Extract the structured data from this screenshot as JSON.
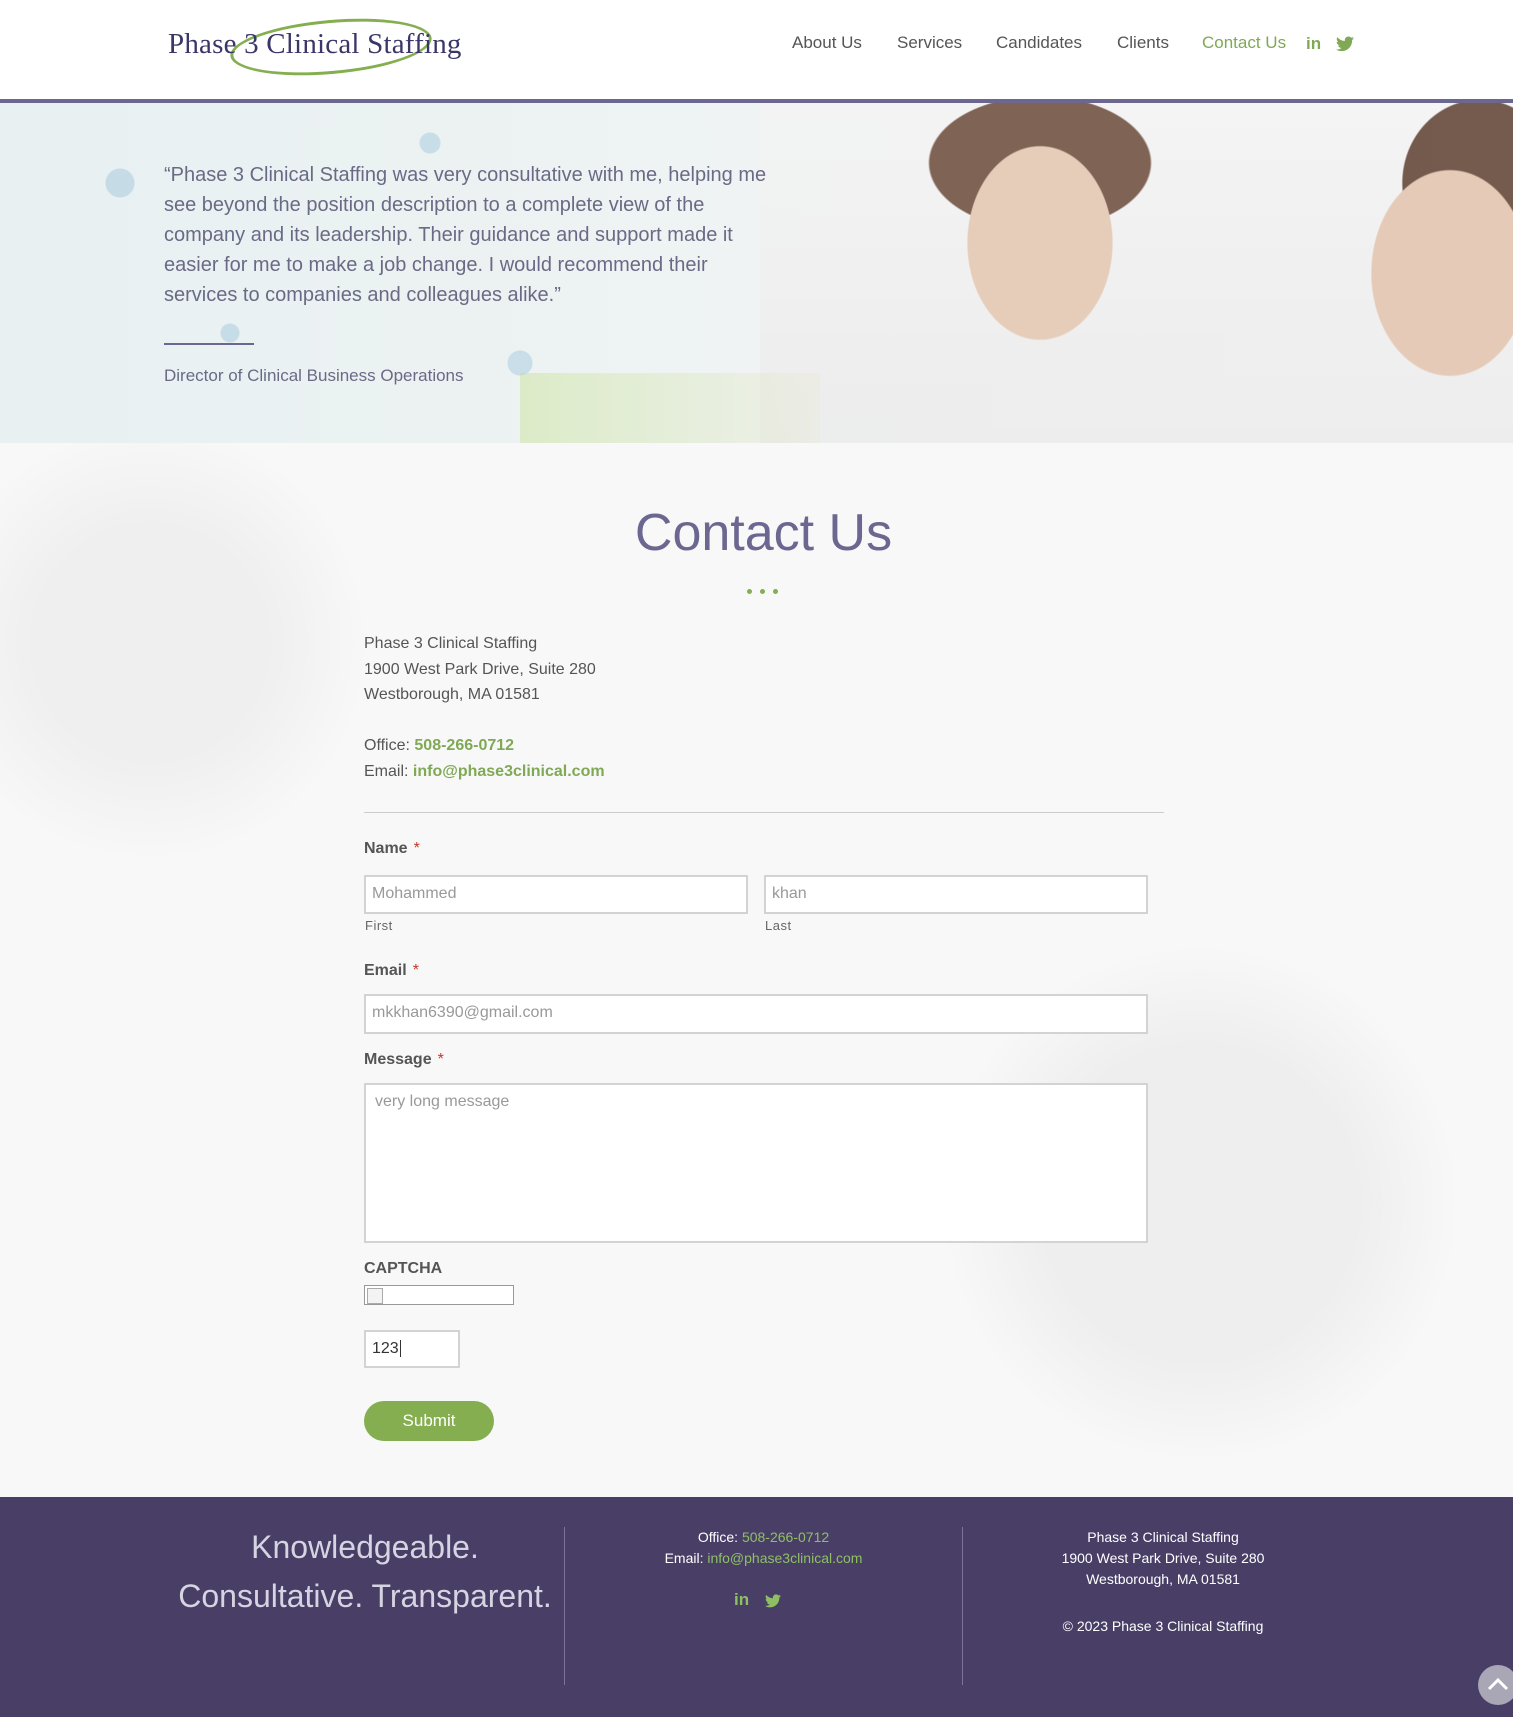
{
  "header": {
    "logo_text": "Phase 3 Clinical Staffing",
    "nav": [
      {
        "label": "About Us"
      },
      {
        "label": "Services"
      },
      {
        "label": "Candidates"
      },
      {
        "label": "Clients"
      },
      {
        "label": "Contact Us",
        "active": true
      }
    ],
    "social": {
      "linkedin_label": "in",
      "twitter_icon": "twitter-icon"
    }
  },
  "hero": {
    "quote": "“Phase 3 Clinical Staffing was very consultative with me, helping me see beyond the position description to a complete view of the company and its leadership. Their guidance and support made it easier for me to make a job change. I would recommend their services to companies and colleagues alike.”",
    "author": "Director of Clinical Business Operations"
  },
  "contact": {
    "title": "Contact Us",
    "company": "Phase 3 Clinical Staffing",
    "address_line1": "1900 West Park Drive, Suite 280",
    "address_line2": "Westborough, MA 01581",
    "office_label": "Office:",
    "office_phone": "508-266-0712",
    "email_label": "Email:",
    "email": "info@phase3clinical.com"
  },
  "form": {
    "name_label": "Name",
    "required_mark": "*",
    "first_value": "Mohammed",
    "first_sublabel": "First",
    "last_value": "khan",
    "last_sublabel": "Last",
    "email_label": "Email",
    "email_value": "mkkhan6390@gmail.com",
    "message_label": "Message",
    "message_value": "very long message",
    "captcha_label": "CAPTCHA",
    "captcha_value": "123",
    "submit_label": "Submit"
  },
  "footer": {
    "tagline_line1": "Knowledgeable.",
    "tagline_line2": "Consultative. Transparent.",
    "office_label": "Office:",
    "office_phone": "508-266-0712",
    "email_label": "Email:",
    "email": "info@phase3clinical.com",
    "linkedin_label": "in",
    "company": "Phase 3 Clinical Staffing",
    "address_line1": "1900 West Park Drive, Suite 280",
    "address_line2": "Westborough, MA 01581",
    "copyright": "© 2023 Phase 3 Clinical Staffing"
  },
  "colors": {
    "brand_purple": "#483e66",
    "accent_green": "#84ae4f",
    "title_purple": "#6b6790"
  }
}
